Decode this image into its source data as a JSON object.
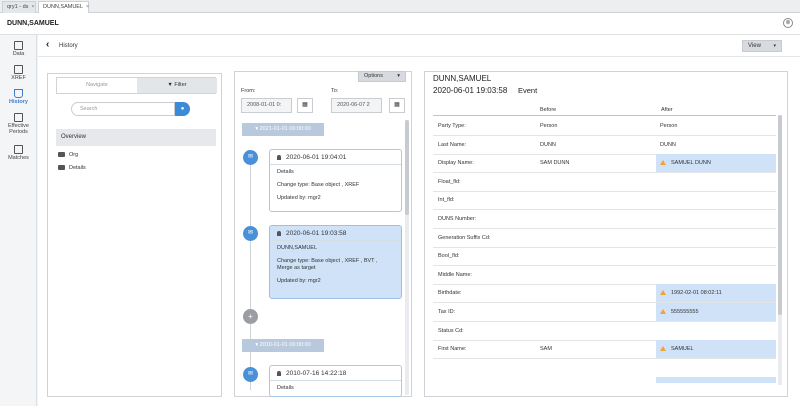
{
  "tabs": [
    {
      "label": "qry1 - ds",
      "close": "×"
    },
    {
      "label": "DUNN,SAMUEL",
      "close": "×"
    }
  ],
  "record": {
    "title": "DUNN,SAMUEL",
    "close_icon": "⊗"
  },
  "leftnav": [
    {
      "label": "Data",
      "icon": "table-icon"
    },
    {
      "label": "XREF",
      "icon": "xref-icon"
    },
    {
      "label": "History",
      "icon": "hourglass-icon",
      "active": true
    },
    {
      "label": "Effective Periods",
      "icon": "calendar-icon"
    },
    {
      "label": "Matches",
      "icon": "matches-icon"
    }
  ],
  "history_bar": {
    "back": "‹",
    "label": "History",
    "view_label": "View",
    "view_caret": "▾"
  },
  "left_panel": {
    "tab_navigate": "Navigate",
    "tab_filter": "Filter",
    "search_placeholder": "Search",
    "overview": "Overview",
    "tree": [
      "Org",
      "Details"
    ]
  },
  "mid_panel": {
    "options_label": "Options",
    "options_caret": "▾",
    "from_label": "From:",
    "from_value": "2008-01-01 0:",
    "to_label": "To:",
    "to_value": "2020-06-07 2",
    "groups": [
      "▾ 2021-01-01 00:00:00",
      "▾ 2010-01-01 00:00:00"
    ],
    "events": [
      {
        "date": "2020-06-01 19:04:01",
        "lines": [
          "Details",
          "Change type: Base object , XREF",
          "Updated by: mgr2"
        ]
      },
      {
        "date": "2020-06-01 19:03:58",
        "lines": [
          "DUNN,SAMUEL",
          "Change type: Base object , XREF , BVT , Merge as target",
          "Updated by: mgr2"
        ]
      },
      {
        "date": "2010-07-16 14:22:18",
        "lines": [
          "Details"
        ]
      }
    ],
    "add_icon": "+"
  },
  "right_panel": {
    "name": "DUNN,SAMUEL",
    "date": "2020-06-01 19:03:58",
    "event_label": "Event",
    "before_header": "Before",
    "after_header": "After",
    "rows": [
      {
        "field": "Party Type:",
        "before": "Person",
        "after": "Person",
        "changed": false
      },
      {
        "field": "Last Name:",
        "before": "DUNN",
        "after": "DUNN",
        "changed": false
      },
      {
        "field": "Display Name:",
        "before": "SAM DUNN",
        "after": "SAMUEL DUNN",
        "changed": true
      },
      {
        "field": "Float_fld:",
        "before": "",
        "after": "",
        "changed": false
      },
      {
        "field": "Int_fld:",
        "before": "",
        "after": "",
        "changed": false
      },
      {
        "field": "DUNS Number:",
        "before": "",
        "after": "",
        "changed": false
      },
      {
        "field": "Generation Suffix Cd:",
        "before": "",
        "after": "",
        "changed": false
      },
      {
        "field": "Bool_fld:",
        "before": "",
        "after": "",
        "changed": false
      },
      {
        "field": "Middle Name:",
        "before": "",
        "after": "",
        "changed": false
      },
      {
        "field": "Birthdate:",
        "before": "",
        "after": "1992-02-01 08:02:11",
        "changed": true
      },
      {
        "field": "Tax ID:",
        "before": "",
        "after": "555555555",
        "changed": true
      },
      {
        "field": "Status Cd:",
        "before": "",
        "after": "",
        "changed": false
      },
      {
        "field": "First Name:",
        "before": "SAM",
        "after": "SAMUEL",
        "changed": true
      }
    ]
  }
}
